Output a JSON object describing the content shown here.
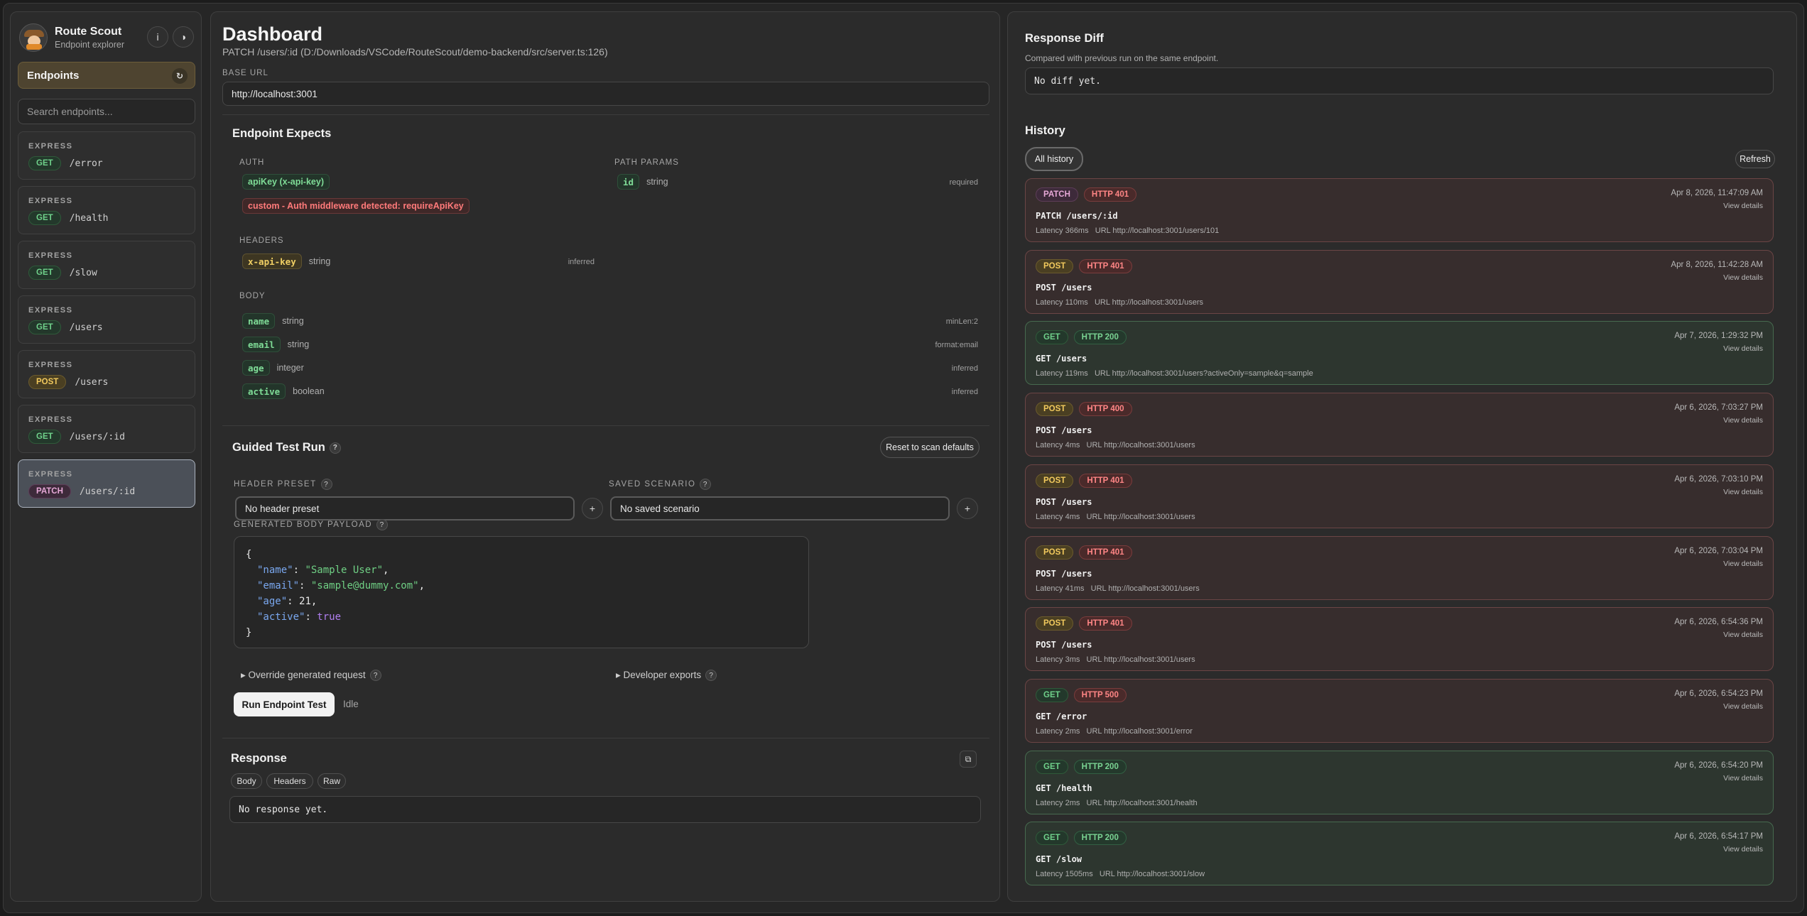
{
  "brand": {
    "title": "Route Scout",
    "subtitle": "Endpoint explorer",
    "info_glyph": "i",
    "theme_glyph": "◑"
  },
  "sidebar": {
    "nav_label": "Endpoints",
    "refresh_glyph": "↻",
    "search_placeholder": "Search endpoints...",
    "endpoints": [
      {
        "framework": "EXPRESS",
        "method": "GET",
        "path": "/error"
      },
      {
        "framework": "EXPRESS",
        "method": "GET",
        "path": "/health"
      },
      {
        "framework": "EXPRESS",
        "method": "GET",
        "path": "/slow"
      },
      {
        "framework": "EXPRESS",
        "method": "GET",
        "path": "/users"
      },
      {
        "framework": "EXPRESS",
        "method": "POST",
        "path": "/users"
      },
      {
        "framework": "EXPRESS",
        "method": "GET",
        "path": "/users/:id"
      },
      {
        "framework": "EXPRESS",
        "method": "PATCH",
        "path": "/users/:id"
      }
    ]
  },
  "dashboard": {
    "title": "Dashboard",
    "subpath": "PATCH /users/:id (D:/Downloads/VSCode/RouteScout/demo-backend/src/server.ts:126)",
    "base_url_label": "BASE URL",
    "base_url_value": "http://localhost:3001"
  },
  "expects": {
    "title": "Endpoint Expects",
    "auth_label": "AUTH",
    "auth_chips": [
      "apiKey (x-api-key)",
      "custom - Auth middleware detected: requireApiKey"
    ],
    "path_params_label": "PATH PARAMS",
    "path_params": [
      {
        "name": "id",
        "type": "string",
        "note": "required"
      }
    ],
    "headers_label": "HEADERS",
    "headers": [
      {
        "name": "x-api-key",
        "type": "string",
        "note": "inferred"
      }
    ],
    "body_label": "BODY",
    "body": [
      {
        "name": "name",
        "type": "string",
        "note": "minLen:2"
      },
      {
        "name": "email",
        "type": "string",
        "note": "format:email"
      },
      {
        "name": "age",
        "type": "integer",
        "note": "inferred"
      },
      {
        "name": "active",
        "type": "boolean",
        "note": "inferred"
      }
    ]
  },
  "guided": {
    "title": "Guided Test Run",
    "help": "?",
    "reset_label": "Reset to scan defaults",
    "header_preset_label": "HEADER PRESET",
    "header_preset_value": "No header preset",
    "saved_scenario_label": "SAVED SCENARIO",
    "saved_scenario_value": "No saved scenario",
    "add_glyph": "+",
    "payload_label": "GENERATED BODY PAYLOAD",
    "payload": {
      "open": "{",
      "close": "}",
      "k1": "\"name\"",
      "v1": "\"Sample User\"",
      "k2": "\"email\"",
      "v2": "\"sample@dummy.com\"",
      "k3": "\"age\"",
      "v3": "21",
      "k4": "\"active\"",
      "v4": "true"
    },
    "override_label": "▸ Override generated request",
    "exports_label": "▸ Developer exports",
    "run_label": "Run Endpoint Test",
    "status": "Idle"
  },
  "response": {
    "title": "Response",
    "copy_glyph": "⧉",
    "tabs": [
      "Body",
      "Headers",
      "Raw"
    ],
    "empty": "No response yet."
  },
  "diff": {
    "title": "Response Diff",
    "subtitle": "Compared with previous run on the same endpoint.",
    "empty": "No diff yet."
  },
  "history": {
    "title": "History",
    "filter_label": "All history",
    "refresh_label": "Refresh",
    "view_label": "View details",
    "items": [
      {
        "method": "PATCH",
        "status": "HTTP 401",
        "ok": false,
        "time": "Apr 8, 2026, 11:47:09 AM",
        "req": "PATCH /users/:id",
        "meta": "Latency 366ms   URL http://localhost:3001/users/101"
      },
      {
        "method": "POST",
        "status": "HTTP 401",
        "ok": false,
        "time": "Apr 8, 2026, 11:42:28 AM",
        "req": "POST /users",
        "meta": "Latency 110ms   URL http://localhost:3001/users"
      },
      {
        "method": "GET",
        "status": "HTTP 200",
        "ok": true,
        "time": "Apr 7, 2026, 1:29:32 PM",
        "req": "GET /users",
        "meta": "Latency 119ms   URL http://localhost:3001/users?activeOnly=sample&q=sample"
      },
      {
        "method": "POST",
        "status": "HTTP 400",
        "ok": false,
        "time": "Apr 6, 2026, 7:03:27 PM",
        "req": "POST /users",
        "meta": "Latency 4ms   URL http://localhost:3001/users"
      },
      {
        "method": "POST",
        "status": "HTTP 401",
        "ok": false,
        "time": "Apr 6, 2026, 7:03:10 PM",
        "req": "POST /users",
        "meta": "Latency 4ms   URL http://localhost:3001/users"
      },
      {
        "method": "POST",
        "status": "HTTP 401",
        "ok": false,
        "time": "Apr 6, 2026, 7:03:04 PM",
        "req": "POST /users",
        "meta": "Latency 41ms   URL http://localhost:3001/users"
      },
      {
        "method": "POST",
        "status": "HTTP 401",
        "ok": false,
        "time": "Apr 6, 2026, 6:54:36 PM",
        "req": "POST /users",
        "meta": "Latency 3ms   URL http://localhost:3001/users"
      },
      {
        "method": "GET",
        "status": "HTTP 500",
        "ok": false,
        "time": "Apr 6, 2026, 6:54:23 PM",
        "req": "GET /error",
        "meta": "Latency 2ms   URL http://localhost:3001/error"
      },
      {
        "method": "GET",
        "status": "HTTP 200",
        "ok": true,
        "time": "Apr 6, 2026, 6:54:20 PM",
        "req": "GET /health",
        "meta": "Latency 2ms   URL http://localhost:3001/health"
      },
      {
        "method": "GET",
        "status": "HTTP 200",
        "ok": true,
        "time": "Apr 6, 2026, 6:54:17 PM",
        "req": "GET /slow",
        "meta": "Latency 1505ms   URL http://localhost:3001/slow"
      }
    ]
  }
}
